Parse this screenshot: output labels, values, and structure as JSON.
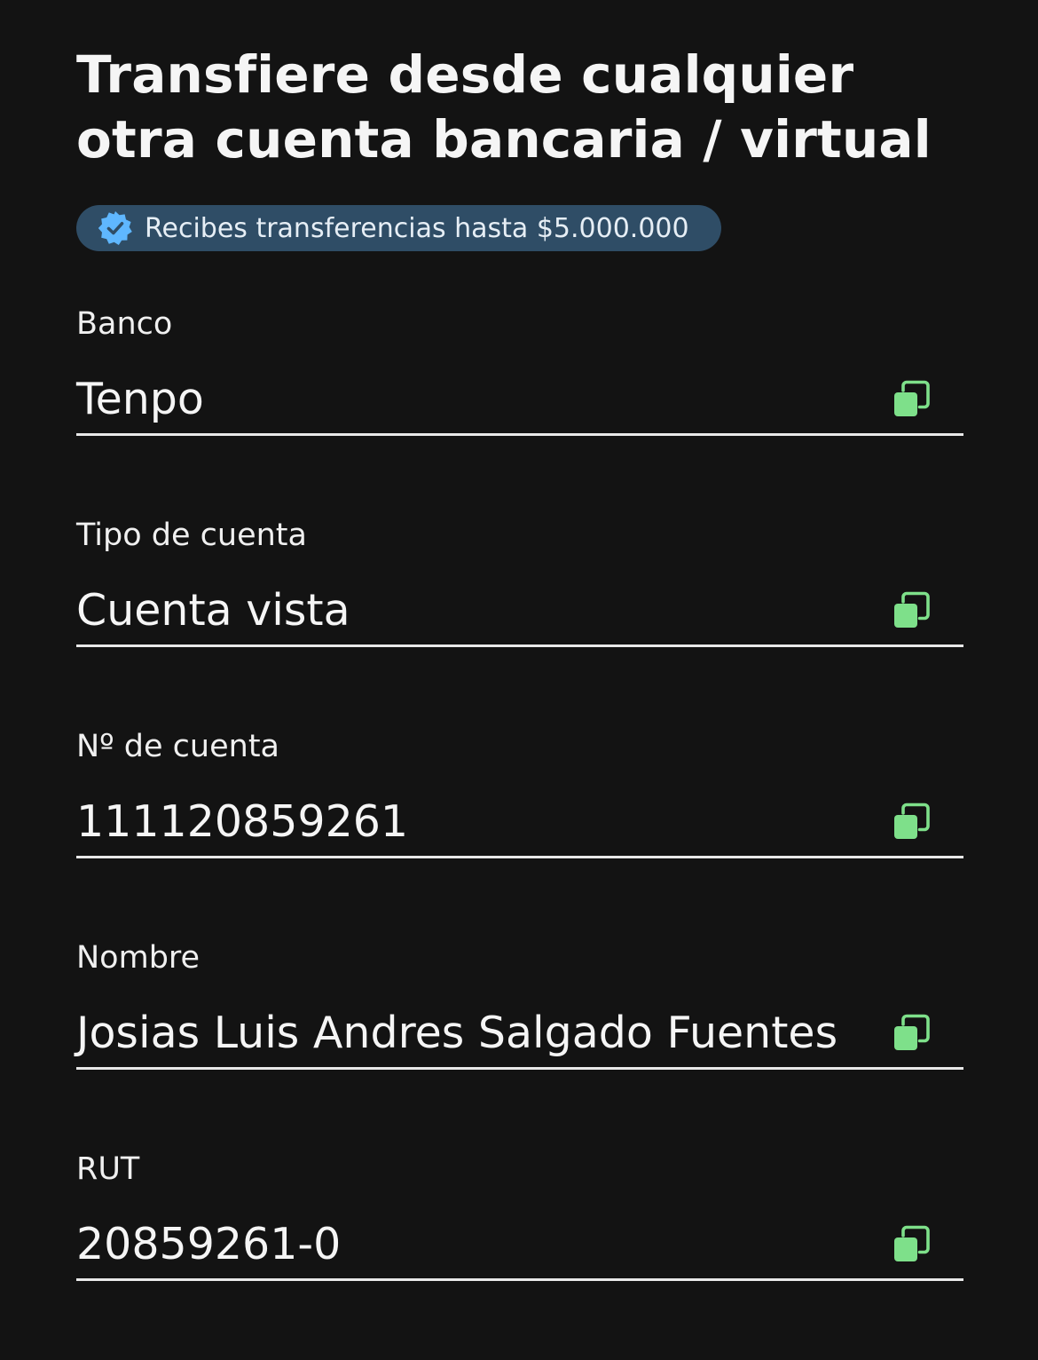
{
  "header": {
    "title": "Transfiere desde cualquier otra cuenta bancaria / virtual"
  },
  "badge": {
    "text": "Recibes transferencias hasta $5.000.000",
    "icon": "verified-check-icon",
    "background": "#2f4d66",
    "icon_color": "#5fb7ff"
  },
  "fields": [
    {
      "label": "Banco",
      "value": "Tenpo",
      "copy_icon": "copy-icon"
    },
    {
      "label": "Tipo de cuenta",
      "value": "Cuenta vista",
      "copy_icon": "copy-icon"
    },
    {
      "label": "Nº de cuenta",
      "value": "111120859261",
      "copy_icon": "copy-icon"
    },
    {
      "label": "Nombre",
      "value": "Josias Luis Andres Salgado Fuentes",
      "copy_icon": "copy-icon"
    },
    {
      "label": "RUT",
      "value": "20859261-0",
      "copy_icon": "copy-icon"
    }
  ],
  "colors": {
    "background": "#131313",
    "accent": "#7ee08a",
    "text": "#f2f2f2"
  }
}
